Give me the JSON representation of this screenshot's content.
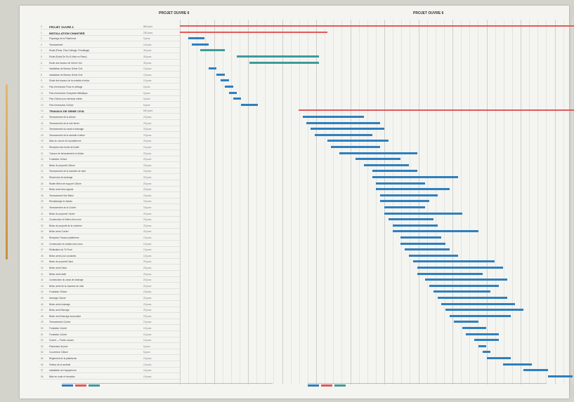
{
  "header": {
    "left_title": "PROJET OUVRE 6",
    "right_title": "PROJET OUVRE 6"
  },
  "tasks": [
    {
      "id": "0",
      "name": "PROJET OUVRE 6",
      "summary": true,
      "dur": "866 jours",
      "start": 0.0,
      "end": 1.0
    },
    {
      "id": "1",
      "name": "INSTALLATION CHANTIER",
      "summary": true,
      "dur": "200 jours",
      "start": 0.0,
      "end": 0.36
    },
    {
      "id": "2",
      "name": "Piquetage de la Plateforme",
      "summary": false,
      "dur": "5 jours",
      "start": 0.02,
      "end": 0.06
    },
    {
      "id": "3",
      "name": "Terrassement",
      "summary": false,
      "dur": "10 jours",
      "start": 0.03,
      "end": 0.07
    },
    {
      "id": "4",
      "name": "Etude (Plans, Plan Coffrage, Ferraillage)",
      "summary": false,
      "dur": "30 jours",
      "start": 0.05,
      "end": 0.11
    },
    {
      "id": "5",
      "name": "Etude (Essai De Sol & Mise en Place)",
      "summary": false,
      "dur": "30 jours",
      "start": 0.14,
      "end": 0.34
    },
    {
      "id": "6",
      "name": "Etude des travaux de Génie Civil",
      "summary": false,
      "dur": "30 jours",
      "start": 0.17,
      "end": 0.34
    },
    {
      "id": "7",
      "name": "Installation de Bureau Génie Civil",
      "summary": false,
      "dur": "10 jours",
      "start": 0.07,
      "end": 0.09
    },
    {
      "id": "8",
      "name": "Installation de Bureau Génie Civil",
      "summary": false,
      "dur": "10 jours",
      "start": 0.09,
      "end": 0.11
    },
    {
      "id": "9",
      "name": "Etude des travaux de la centrale à béton",
      "summary": false,
      "dur": "10 jours",
      "start": 0.1,
      "end": 0.12
    },
    {
      "id": "10",
      "name": "Plan d'exécution Pose et coffrage",
      "summary": false,
      "dur": "5 jours",
      "start": 0.11,
      "end": 0.13
    },
    {
      "id": "11",
      "name": "Plan d'exécution Charpente Métallique",
      "summary": false,
      "dur": "5 jours",
      "start": 0.12,
      "end": 0.14
    },
    {
      "id": "12",
      "name": "Plan Clôture pour terrasse entrée",
      "summary": false,
      "dur": "5 jours",
      "start": 0.13,
      "end": 0.15
    },
    {
      "id": "13",
      "name": "Plan d'exécution Clôture",
      "summary": false,
      "dur": "5 jours",
      "start": 0.15,
      "end": 0.19
    },
    {
      "id": "14",
      "name": "TRAVAUX DE GENIE CIVIL",
      "summary": true,
      "dur": "600 jours",
      "start": 0.29,
      "end": 0.97
    },
    {
      "id": "15",
      "name": "Terrassement de la clôture",
      "summary": false,
      "dur": "20 jours",
      "start": 0.3,
      "end": 0.45
    },
    {
      "id": "16",
      "name": "Terrassement de la voie ferrée",
      "summary": false,
      "dur": "20 jours",
      "start": 0.31,
      "end": 0.49
    },
    {
      "id": "17",
      "name": "Terrassement du canal et drainage",
      "summary": false,
      "dur": "20 jours",
      "start": 0.32,
      "end": 0.5
    },
    {
      "id": "18",
      "name": "Terrassement de la centrale à béton",
      "summary": false,
      "dur": "15 jours",
      "start": 0.33,
      "end": 0.47
    },
    {
      "id": "19",
      "name": "Mise en oeuvre de la plateforme",
      "summary": false,
      "dur": "20 jours",
      "start": 0.36,
      "end": 0.51
    },
    {
      "id": "20",
      "name": "Réception des fonds de fouille",
      "summary": false,
      "dur": "10 jours",
      "start": 0.37,
      "end": 0.49
    },
    {
      "id": "21",
      "name": "Travaux de terrassement et clôture",
      "summary": false,
      "dur": "20 jours",
      "start": 0.39,
      "end": 0.58
    },
    {
      "id": "22",
      "name": "Fondation Clôture",
      "summary": false,
      "dur": "20 jours",
      "start": 0.43,
      "end": 0.54
    },
    {
      "id": "23",
      "name": "Béton de propreté Clôture",
      "summary": false,
      "dur": "20 jours",
      "start": 0.45,
      "end": 0.56
    },
    {
      "id": "24",
      "name": "Terrassement de la chambre de relai",
      "summary": false,
      "dur": "15 jours",
      "start": 0.47,
      "end": 0.58
    },
    {
      "id": "25",
      "name": "Réservoirs de stockage",
      "summary": false,
      "dur": "20 jours",
      "start": 0.47,
      "end": 0.68
    },
    {
      "id": "26",
      "name": "Radier Béton de support Clôture",
      "summary": false,
      "dur": "20 jours",
      "start": 0.48,
      "end": 0.6
    },
    {
      "id": "27",
      "name": "Béton armé des regards",
      "summary": false,
      "dur": "20 jours",
      "start": 0.48,
      "end": 0.66
    },
    {
      "id": "28",
      "name": "Terrassement Mur Béton",
      "summary": false,
      "dur": "15 jours",
      "start": 0.49,
      "end": 0.63
    },
    {
      "id": "29",
      "name": "Remplissage du bassin",
      "summary": false,
      "dur": "15 jours",
      "start": 0.49,
      "end": 0.61
    },
    {
      "id": "30",
      "name": "Terrassement de la Culvert",
      "summary": false,
      "dur": "15 jours",
      "start": 0.5,
      "end": 0.6
    },
    {
      "id": "31",
      "name": "Béton de propreté Culvert",
      "summary": false,
      "dur": "20 jours",
      "start": 0.5,
      "end": 0.69
    },
    {
      "id": "32",
      "name": "Construction et finition des murs",
      "summary": false,
      "dur": "20 jours",
      "start": 0.51,
      "end": 0.62
    },
    {
      "id": "33",
      "name": "Béton de propreté de la chambre",
      "summary": false,
      "dur": "20 jours",
      "start": 0.52,
      "end": 0.63
    },
    {
      "id": "34",
      "name": "Béton armé Culvert",
      "summary": false,
      "dur": "20 jours",
      "start": 0.52,
      "end": 0.73
    },
    {
      "id": "35",
      "name": "Réception Travaux plateforme",
      "summary": false,
      "dur": "10 jours",
      "start": 0.54,
      "end": 0.64
    },
    {
      "id": "36",
      "name": "Construction et création des murs",
      "summary": false,
      "dur": "10 jours",
      "start": 0.54,
      "end": 0.65
    },
    {
      "id": "37",
      "name": "Réalisation du Tir Final",
      "summary": false,
      "dur": "10 jours",
      "start": 0.55,
      "end": 0.66
    },
    {
      "id": "38",
      "name": "Béton armé pour conduites",
      "summary": false,
      "dur": "10 jours",
      "start": 0.56,
      "end": 0.68
    },
    {
      "id": "39",
      "name": "Béton de propreté Dalot",
      "summary": false,
      "dur": "20 jours",
      "start": 0.57,
      "end": 0.77
    },
    {
      "id": "40",
      "name": "Béton armé Dalot",
      "summary": false,
      "dur": "20 jours",
      "start": 0.58,
      "end": 0.79
    },
    {
      "id": "41",
      "name": "Béton armé dalle",
      "summary": false,
      "dur": "20 jours",
      "start": 0.58,
      "end": 0.74
    },
    {
      "id": "42",
      "name": "Construction du canal de drainage",
      "summary": false,
      "dur": "20 jours",
      "start": 0.6,
      "end": 0.8
    },
    {
      "id": "43",
      "name": "Béton armé de la chambre de relai",
      "summary": false,
      "dur": "20 jours",
      "start": 0.61,
      "end": 0.78
    },
    {
      "id": "44",
      "name": "Fondation Clôture",
      "summary": false,
      "dur": "15 jours",
      "start": 0.62,
      "end": 0.76
    },
    {
      "id": "45",
      "name": "Montage Clôture",
      "summary": false,
      "dur": "20 jours",
      "start": 0.63,
      "end": 0.8
    },
    {
      "id": "46",
      "name": "Béton armé drainage",
      "summary": false,
      "dur": "20 jours",
      "start": 0.64,
      "end": 0.82
    },
    {
      "id": "47",
      "name": "Béton armé Barrage",
      "summary": false,
      "dur": "20 jours",
      "start": 0.65,
      "end": 0.84
    },
    {
      "id": "48",
      "name": "Béton armé Barrage secondaire",
      "summary": false,
      "dur": "20 jours",
      "start": 0.66,
      "end": 0.81
    },
    {
      "id": "49",
      "name": "Terrassement Culvert",
      "summary": false,
      "dur": "10 jours",
      "start": 0.67,
      "end": 0.73
    },
    {
      "id": "50",
      "name": "Fondation Culvert",
      "summary": false,
      "dur": "10 jours",
      "start": 0.69,
      "end": 0.75
    },
    {
      "id": "51",
      "name": "Fondation Culvert",
      "summary": false,
      "dur": "10 jours",
      "start": 0.7,
      "end": 0.78
    },
    {
      "id": "52",
      "name": "Culvert — Partie courant",
      "summary": false,
      "dur": "10 jours",
      "start": 0.72,
      "end": 0.78
    },
    {
      "id": "53",
      "name": "Placement de joint",
      "summary": false,
      "dur": "5 jours",
      "start": 0.73,
      "end": 0.75
    },
    {
      "id": "54",
      "name": "Couverture Clôture",
      "summary": false,
      "dur": "5 jours",
      "start": 0.74,
      "end": 0.76
    },
    {
      "id": "55",
      "name": "Réglement de la plateforme",
      "summary": false,
      "dur": "10 jours",
      "start": 0.75,
      "end": 0.81
    },
    {
      "id": "56",
      "name": "Finition de la centrale",
      "summary": false,
      "dur": "10 jours",
      "start": 0.79,
      "end": 0.86
    },
    {
      "id": "57",
      "name": "Installation de l'équipement",
      "summary": false,
      "dur": "10 jours",
      "start": 0.84,
      "end": 0.9
    },
    {
      "id": "58",
      "name": "Mise en route et réception",
      "summary": false,
      "dur": "10 jours",
      "start": 0.9,
      "end": 0.96
    }
  ],
  "colors": {
    "task": "#2e7fbe",
    "summary": "#e15a5a",
    "teal": "#3f9a9a"
  }
}
